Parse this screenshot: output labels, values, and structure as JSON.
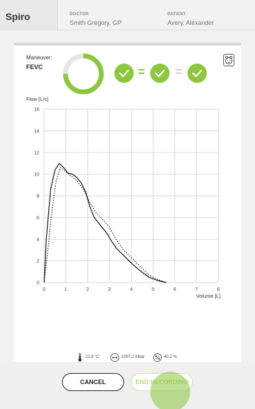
{
  "header": {
    "app_title": "Spiro",
    "doctor_label": "DOCTOR",
    "doctor_name": "Smith Gregory, GP",
    "patient_label": "PATIENT",
    "patient_name": "Avery, Alexander"
  },
  "maneuver": {
    "label": "Maneuver:",
    "value": "FEVC",
    "progress": 0.75,
    "checks": [
      "check-icon",
      "check-icon",
      "check-icon"
    ],
    "equals": [
      "=",
      "="
    ],
    "baby_icon": "baby-face-icon"
  },
  "chart_data": {
    "type": "line",
    "ylabel": "Flow [L/s]",
    "xlabel": "Volume [L]",
    "xlim": [
      0,
      8
    ],
    "ylim": [
      0,
      16
    ],
    "xticks": [
      0,
      1,
      2,
      3,
      4,
      5,
      6,
      7,
      8
    ],
    "yticks": [
      0,
      2,
      4,
      6,
      8,
      10,
      12,
      14,
      16
    ],
    "grid": true,
    "series": [
      {
        "style": "solid",
        "x": [
          0,
          0.1,
          0.3,
          0.5,
          0.7,
          0.9,
          1.1,
          1.3,
          1.5,
          1.7,
          1.9,
          2.1,
          2.3,
          2.5,
          2.7,
          2.9,
          3.1,
          3.3,
          3.6,
          4.0,
          4.4,
          4.8,
          5.2,
          5.6
        ],
        "y": [
          0,
          4,
          8.6,
          10.4,
          11.0,
          10.6,
          10.1,
          10.0,
          9.7,
          9.2,
          8.4,
          7.0,
          6.0,
          5.5,
          5.0,
          4.5,
          3.8,
          3.2,
          2.6,
          1.8,
          1.1,
          0.5,
          0.2,
          0
        ]
      },
      {
        "style": "dotted",
        "x": [
          0,
          0.15,
          0.35,
          0.55,
          0.75,
          0.95,
          1.2,
          1.5,
          1.8,
          2.1,
          2.4,
          2.7,
          3.0,
          3.3,
          3.6,
          4.0,
          4.4,
          4.8,
          5.2,
          5.6
        ],
        "y": [
          0,
          2.5,
          6.5,
          9.4,
          10.6,
          10.3,
          9.9,
          9.4,
          8.6,
          7.4,
          6.4,
          5.8,
          5.1,
          4.0,
          3.1,
          2.3,
          1.5,
          0.7,
          0.3,
          0
        ]
      }
    ]
  },
  "conditions": {
    "temperature": "21.8 °C",
    "pressure": "1007.2 mbar",
    "humidity": "40.2 %"
  },
  "actions": {
    "cancel": "CANCEL",
    "end": "END RECORDING"
  },
  "colors": {
    "accent": "#8dc63f",
    "accent_light": "#b7dd86"
  }
}
